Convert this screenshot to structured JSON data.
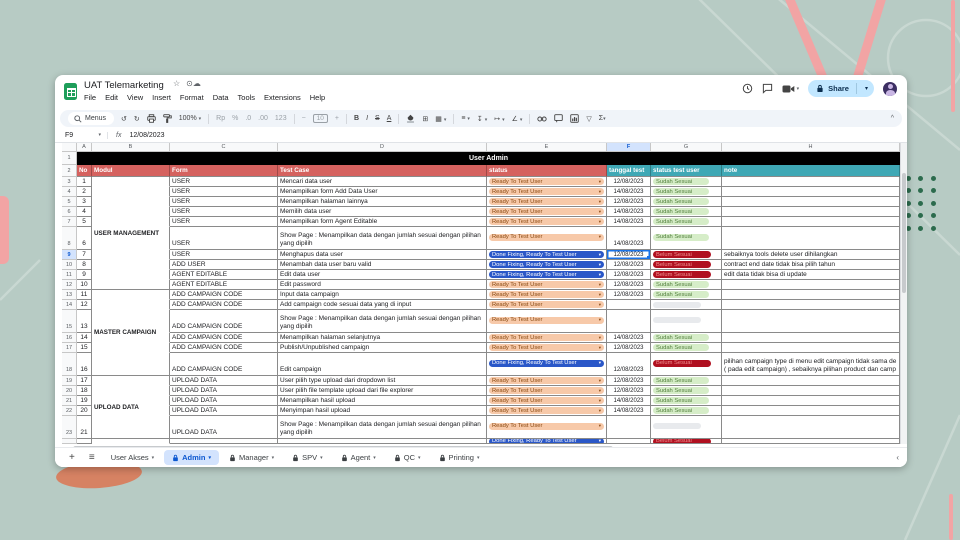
{
  "window": {
    "title": "UAT Telemarketing",
    "menus": [
      "File",
      "Edit",
      "View",
      "Insert",
      "Format",
      "Data",
      "Tools",
      "Extensions",
      "Help"
    ],
    "share_label": "Share"
  },
  "icons": {
    "star": "☆",
    "cloud": "☁",
    "undo": "↺",
    "redo": "↻",
    "bold": "B",
    "italic": "I",
    "strikethrough": "S",
    "text_color": "A",
    "borders": "⊞",
    "merge": "▦",
    "h_align": "≡",
    "v_align": "↧",
    "wrap_text": "↦",
    "rotate": "∠",
    "filter": "▽",
    "functions": "Σ",
    "collapse": "^",
    "caret": "▾",
    "minus": "−",
    "plus": "+"
  },
  "toolbar": {
    "menus_label": "Menus",
    "zoom": "100%",
    "currency": "Rp",
    "percent": "%",
    "decimal_decrease": ".0",
    "decimal_increase": ".00",
    "number_format": "123",
    "font_size": "10"
  },
  "formula_bar": {
    "cell_ref": "F9",
    "value": "12/08/2023"
  },
  "grid": {
    "column_letters": [
      "A",
      "B",
      "C",
      "D",
      "E",
      "F",
      "G",
      "H"
    ],
    "selected_column": "F",
    "selected_row": 9,
    "selected_cell": "F9",
    "banner": "User Admin",
    "headers": [
      "No",
      "Modul",
      "Form",
      "Test Case",
      "status",
      "tanggal test",
      "status test user",
      "note"
    ],
    "modul_groups": [
      {
        "label": "USER MANAGEMENT",
        "from": 3,
        "to": 12
      },
      {
        "label": "MASTER CAMPAIGN",
        "from": 13,
        "to": 18
      },
      {
        "label": "UPLOAD DATA",
        "from": 19,
        "to": 23
      }
    ],
    "rows": [
      {
        "row": 3,
        "no": "1",
        "form": "USER",
        "test_case": "Mencari data user",
        "status": "Ready To Test User",
        "status_type": "ready",
        "date": "12/08/2023",
        "result": "Sudah Sesuai",
        "result_type": "ok",
        "note": ""
      },
      {
        "row": 4,
        "no": "2",
        "form": "USER",
        "test_case": "Menampilkan form Add Data User",
        "status": "Ready To Test User",
        "status_type": "ready",
        "date": "14/08/2023",
        "result": "Sudah Sesuai",
        "result_type": "ok",
        "note": ""
      },
      {
        "row": 5,
        "no": "3",
        "form": "USER",
        "test_case": "Menampilkan halaman lainnya",
        "status": "Ready To Test User",
        "status_type": "ready",
        "date": "12/08/2023",
        "result": "Sudah Sesuai",
        "result_type": "ok",
        "note": ""
      },
      {
        "row": 6,
        "no": "4",
        "form": "USER",
        "test_case": "Memilih data user",
        "status": "Ready To Test User",
        "status_type": "ready",
        "date": "14/08/2023",
        "result": "Sudah Sesuai",
        "result_type": "ok",
        "note": ""
      },
      {
        "row": 7,
        "no": "5",
        "form": "USER",
        "test_case": "Menampilkan form Agent Editable",
        "status": "Ready To Test User",
        "status_type": "ready",
        "date": "14/08/2023",
        "result": "Sudah Sesuai",
        "result_type": "ok",
        "note": ""
      },
      {
        "row": 8,
        "no": "6",
        "form": "USER",
        "test_case": "Show Page : Menampilkan data dengan jumlah sesuai dengan pilihan yang dipilih",
        "status": "Ready To Test User",
        "status_type": "ready",
        "date": "14/08/2023",
        "result": "Sudah Sesuai",
        "result_type": "ok",
        "note": "",
        "tall": true
      },
      {
        "row": 9,
        "no": "7",
        "form": "USER",
        "test_case": "Menghapus data user",
        "status": "Done Fixing, Ready To Test User",
        "status_type": "done",
        "date": "12/08/2023",
        "result": "Belum Sesuai",
        "result_type": "bad",
        "note": "sebaiknya tools delete user dihilangkan",
        "selected": true
      },
      {
        "row": 10,
        "no": "8",
        "form": "ADD USER",
        "test_case": "Menambah data user baru valid",
        "status": "Done Fixing, Ready To Test User",
        "status_type": "done",
        "date": "12/08/2023",
        "result": "Belum Sesuai",
        "result_type": "bad",
        "note": "contract end date tidak bisa pilih tahun"
      },
      {
        "row": 11,
        "no": "9",
        "form": "AGENT EDITABLE",
        "test_case": "Edit data user",
        "status": "Done Fixing, Ready To Test User",
        "status_type": "done",
        "date": "12/08/2023",
        "result": "Belum Sesuai",
        "result_type": "bad",
        "note": "edit data tidak bisa di update"
      },
      {
        "row": 12,
        "no": "10",
        "form": "AGENT EDITABLE",
        "test_case": "Edit password",
        "status": "Ready To Test User",
        "status_type": "ready",
        "date": "12/08/2023",
        "result": "Sudah Sesuai",
        "result_type": "ok",
        "note": ""
      },
      {
        "row": 13,
        "no": "11",
        "form": "ADD CAMPAIGN CODE",
        "test_case": "Input data campaign",
        "status": "Ready To Test User",
        "status_type": "ready",
        "date": "12/08/2023",
        "result": "Sudah Sesuai",
        "result_type": "ok",
        "note": ""
      },
      {
        "row": 14,
        "no": "12",
        "form": "ADD CAMPAIGN CODE",
        "test_case": "Add campaign code sesuai data yang di input",
        "status": "Ready To Test User",
        "status_type": "ready",
        "date": "",
        "result": "",
        "result_type": "empty",
        "note": ""
      },
      {
        "row": 15,
        "no": "13",
        "form": "ADD CAMPAIGN CODE",
        "test_case": "Show Page : Menampilkan data dengan jumlah sesuai dengan pilihan yang dipilih",
        "status": "Ready To Test User",
        "status_type": "ready",
        "date": "",
        "result": "",
        "result_type": "empty",
        "note": "",
        "tall": true
      },
      {
        "row": 16,
        "no": "14",
        "form": "ADD CAMPAIGN CODE",
        "test_case": "Menampilkan halaman selanjutnya",
        "status": "Ready To Test User",
        "status_type": "ready",
        "date": "14/08/2023",
        "result": "Sudah Sesuai",
        "result_type": "ok",
        "note": ""
      },
      {
        "row": 17,
        "no": "15",
        "form": "ADD CAMPAIGN CODE",
        "test_case": "Publish/Unpublished campaign",
        "status": "Ready To Test User",
        "status_type": "ready",
        "date": "12/08/2023",
        "result": "Sudah Sesuai",
        "result_type": "ok",
        "note": ""
      },
      {
        "row": 18,
        "no": "16",
        "form": "ADD CAMPAIGN CODE",
        "test_case": "Edit campaign",
        "status": "Done Fixing, Ready To Test User",
        "status_type": "done",
        "date": "12/08/2023",
        "result": "Belum Sesuai",
        "result_type": "bad",
        "note": "pilihan campaign type di menu edit campaign tidak sama de ( pada edit campaign) , sebaiknya pilihan product dan camp",
        "tall": true
      },
      {
        "row": 19,
        "no": "17",
        "form": "UPLOAD DATA",
        "test_case": "User pilih type upload dari dropdown list",
        "status": "Ready To Test User",
        "status_type": "ready",
        "date": "12/08/2023",
        "result": "Sudah Sesuai",
        "result_type": "ok",
        "note": ""
      },
      {
        "row": 20,
        "no": "18",
        "form": "UPLOAD DATA",
        "test_case": "User pilih file template upload dari file explorer",
        "status": "Ready To Test User",
        "status_type": "ready",
        "date": "12/08/2023",
        "result": "Sudah Sesuai",
        "result_type": "ok",
        "note": ""
      },
      {
        "row": 21,
        "no": "19",
        "form": "UPLOAD DATA",
        "test_case": "Menampilkan hasil upload",
        "status": "Ready To Test User",
        "status_type": "ready",
        "date": "14/08/2023",
        "result": "Sudah Sesuai",
        "result_type": "ok",
        "note": ""
      },
      {
        "row": 22,
        "no": "20",
        "form": "UPLOAD DATA",
        "test_case": "Menyimpan hasil upload",
        "status": "Ready To Test User",
        "status_type": "ready",
        "date": "14/08/2023",
        "result": "Sudah Sesuai",
        "result_type": "ok",
        "note": ""
      },
      {
        "row": 23,
        "no": "21",
        "form": "UPLOAD DATA",
        "test_case": "Show Page : Menampilkan data dengan jumlah sesuai dengan pilihan yang dipilih",
        "status": "Ready To Test User",
        "status_type": "ready",
        "date": "",
        "result": "",
        "result_type": "empty",
        "note": "",
        "tall": true
      },
      {
        "row": 24,
        "no": "",
        "form": "",
        "test_case": "",
        "status": "Done Fixing, Ready To Test User",
        "status_type": "done",
        "date": "",
        "result": "Belum Sesuai",
        "result_type": "bad",
        "note": "",
        "clipped": true
      }
    ]
  },
  "tabs": {
    "add_label": "+",
    "all_sheets_label": "≡",
    "items": [
      {
        "label": "User Akses",
        "locked": false,
        "active": false
      },
      {
        "label": "Admin",
        "locked": true,
        "active": true
      },
      {
        "label": "Manager",
        "locked": true,
        "active": false
      },
      {
        "label": "SPV",
        "locked": true,
        "active": false
      },
      {
        "label": "Agent",
        "locked": true,
        "active": false
      },
      {
        "label": "QC",
        "locked": true,
        "active": false
      },
      {
        "label": "Printing",
        "locked": true,
        "active": false
      }
    ],
    "scroll_left": "‹"
  },
  "colors": {
    "background": "#b7cbc4",
    "accent_pink": "#f2a4a4",
    "accent_coral": "#d68263",
    "accent_green_dots": "#2c6b4d",
    "header_red": "#d5625f",
    "header_teal": "#3fa8b5",
    "chip_ready_bg": "#f7c9a9",
    "chip_done_bg": "#2a57c8",
    "chip_ok_bg": "#d6edc8",
    "chip_bad_bg": "#b01020",
    "selection_blue": "#1a73e8",
    "share_bg": "#c2e7ff"
  }
}
